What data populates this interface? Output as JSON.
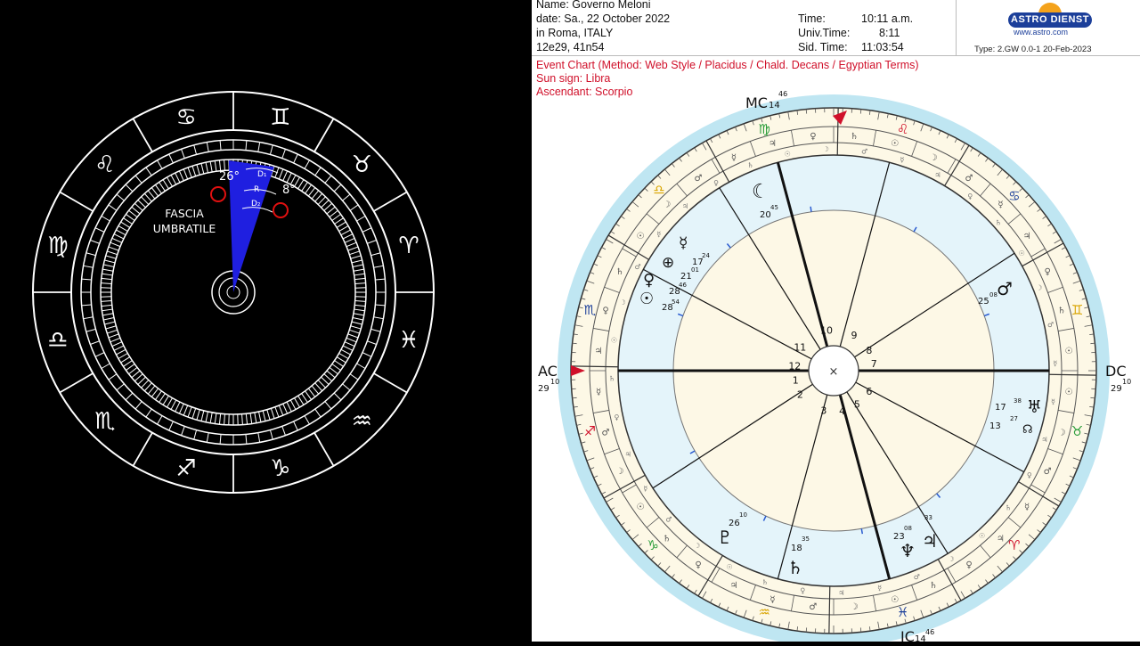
{
  "left_chart": {
    "fascia_label_1": "FASCIA",
    "fascia_label_2": "UMBRATILE",
    "degree_left": "26°",
    "degree_right": "8°",
    "d1_label": "D₁",
    "r_label": "R",
    "d2_label": "D₂",
    "sector_color": "#1f1fe0"
  },
  "header": {
    "name": "Name: Governo Meloni",
    "date": "date: Sa., 22 October 2022",
    "place": "in Roma, ITALY",
    "coords": "12e29, 41n54",
    "time_label": "Time:",
    "time_value": "10:11 a.m.",
    "univ_label": "Univ.Time:",
    "univ_value": "8:11",
    "sid_label": "Sid. Time:",
    "sid_value": "11:03:54"
  },
  "logo": {
    "brand": "ASTRO DIENST",
    "url": "www.astro.com",
    "type_line": "Type: 2.GW   0.0-1  20-Feb-2023"
  },
  "chart_info": {
    "event_line": "Event Chart  (Method: Web Style / Placidus / Chald. Decans / Egyptian Terms)",
    "sun_sign": "Sun sign: Libra",
    "ascendant": "Ascendant: Scorpio"
  },
  "axes": {
    "mc": "MC",
    "mc_deg": "14",
    "mc_min": "46",
    "ic": "IC",
    "ic_deg": "14",
    "ic_min": "46",
    "ac": "AC",
    "ac_deg": "29",
    "ac_min": "10",
    "dc": "DC",
    "dc_deg": "29",
    "dc_min": "10"
  },
  "houses": [
    "1",
    "2",
    "3",
    "4",
    "5",
    "6",
    "7",
    "8",
    "9",
    "10",
    "11",
    "12"
  ],
  "planets": {
    "moon": {
      "glyph": "☾",
      "deg": "20",
      "min": "45"
    },
    "mercury": {
      "glyph": "☿",
      "deg": "21",
      "min": "01"
    },
    "fortune": {
      "glyph": "⊕",
      "deg": "17",
      "min": "24"
    },
    "venus": {
      "glyph": "♀",
      "deg": "28",
      "min": "46"
    },
    "sun": {
      "glyph": "☉",
      "deg": "28",
      "min": "54"
    },
    "mars": {
      "glyph": "♂",
      "deg": "25",
      "min": "08"
    },
    "uranus": {
      "glyph": "♅",
      "deg": "17",
      "min": "38"
    },
    "node": {
      "glyph": "☊",
      "deg": "13",
      "min": "27"
    },
    "pluto": {
      "glyph": "♇",
      "deg": "26",
      "min": "10"
    },
    "saturn": {
      "glyph": "♄",
      "deg": "18",
      "min": "35"
    },
    "neptune": {
      "glyph": "♆",
      "deg": "23",
      "min": "08"
    },
    "jupiter": {
      "glyph": "♃",
      "deg": "",
      "min": "33"
    }
  },
  "center_mark": "×",
  "colors": {
    "outer_ring": "#bfe6f2",
    "house_fill": "#e4f4fa",
    "zodiac_ring": "#fdf8e6",
    "accent_red": "#d0102a",
    "brand_blue": "#1c3f9a"
  }
}
